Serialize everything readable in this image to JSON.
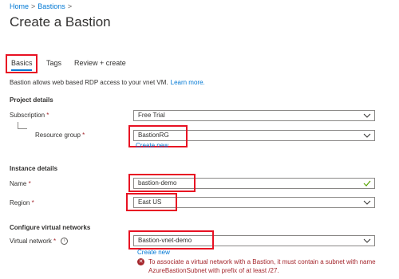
{
  "breadcrumb": {
    "home": "Home",
    "sep1": ">",
    "bastions": "Bastions",
    "sep2": ">"
  },
  "page_title": "Create a Bastion",
  "tabs": [
    {
      "label": "Basics",
      "selected": true
    },
    {
      "label": "Tags",
      "selected": false
    },
    {
      "label": "Review + create",
      "selected": false
    }
  ],
  "description": {
    "text": "Bastion allows web based RDP access to your vnet VM.",
    "link": "Learn more."
  },
  "sections": {
    "project": "Project details",
    "instance": "Instance details",
    "network": "Configure virtual networks"
  },
  "fields": {
    "subscription": {
      "label": "Subscription",
      "required": "*",
      "value": "Free Trial"
    },
    "resource_group": {
      "label": "Resource group",
      "required": "*",
      "value": "BastionRG",
      "create_new": "Create new"
    },
    "name": {
      "label": "Name",
      "required": "*",
      "value": "bastion-demo"
    },
    "region": {
      "label": "Region",
      "required": "*",
      "value": "East US"
    },
    "virtual_network": {
      "label": "Virtual network",
      "required": "*",
      "info": "i",
      "value": "Bastion-vnet-demo",
      "create_new": "Create new"
    }
  },
  "error": {
    "icon": "error-icon",
    "text": "To associate a virtual network with a Bastion, it must contain a subnet with name AzureBastionSubnet with prefix of at least /27."
  },
  "colors": {
    "accent": "#0078d4",
    "highlight": "#e81123",
    "error": "#a4262c",
    "valid": "#57a300"
  }
}
